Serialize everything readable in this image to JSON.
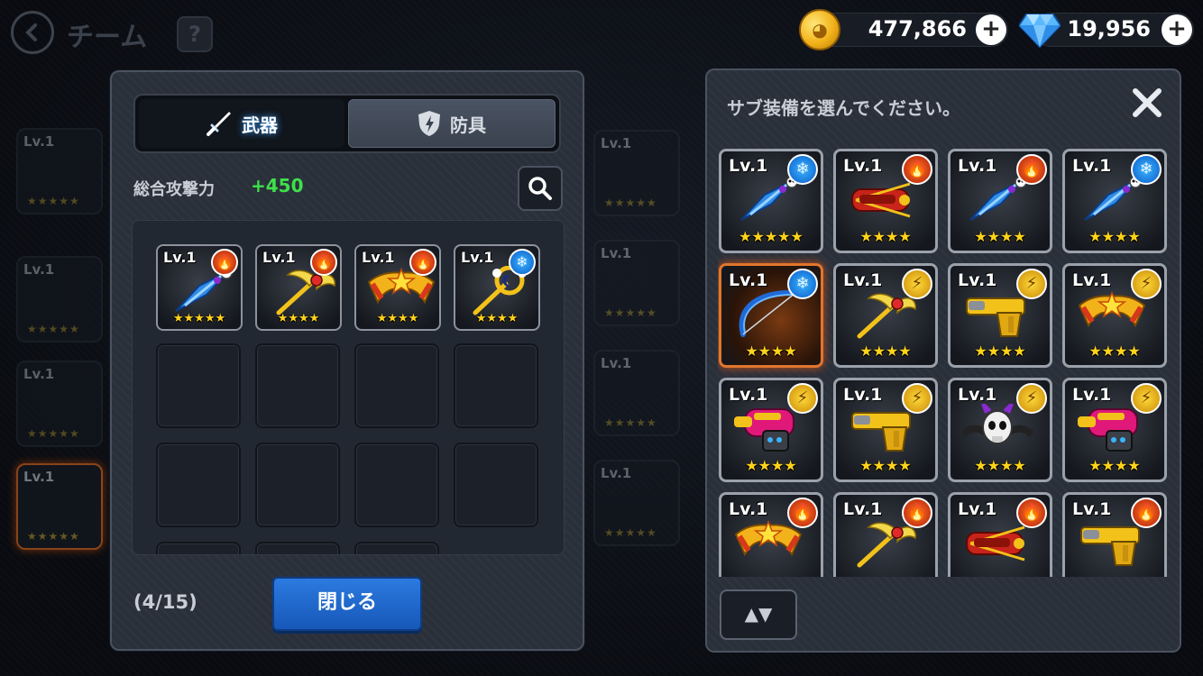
{
  "header": {
    "title": "チーム",
    "help_label": "?"
  },
  "currency": {
    "coins": "477,866",
    "gems": "19,956",
    "plus_label": "+"
  },
  "equip_panel": {
    "tabs": [
      {
        "label": "武器",
        "active": true,
        "icon": "sword-icon"
      },
      {
        "label": "防具",
        "active": false,
        "icon": "shield-icon"
      }
    ],
    "attack_label": "総合攻撃力",
    "attack_value": "+450",
    "count": "(4/15)",
    "close_label": "閉じる",
    "equipped": [
      {
        "level": "Lv.1",
        "element": "fire",
        "stars": "★★★★★",
        "icon": "dagger-icon"
      },
      {
        "level": "Lv.1",
        "element": "fire",
        "stars": "★★★★",
        "icon": "wing-staff-icon"
      },
      {
        "level": "Lv.1",
        "element": "fire",
        "stars": "★★★★",
        "icon": "boomerang-icon"
      },
      {
        "level": "Lv.1",
        "element": "ice",
        "stars": "★★★★",
        "icon": "moon-wand-icon"
      }
    ]
  },
  "select_panel": {
    "title": "サブ装備を選んでください。",
    "sort_label": "▲▼",
    "items": [
      {
        "level": "Lv.1",
        "element": "ice",
        "stars": "★★★★★",
        "icon": "dagger-icon",
        "selected": false
      },
      {
        "level": "Lv.1",
        "element": "fire",
        "stars": "★★★★",
        "icon": "crossbow-icon",
        "selected": false
      },
      {
        "level": "Lv.1",
        "element": "fire",
        "stars": "★★★★",
        "icon": "dagger-icon",
        "selected": false
      },
      {
        "level": "Lv.1",
        "element": "ice",
        "stars": "★★★★",
        "icon": "dagger-icon",
        "selected": false
      },
      {
        "level": "Lv.1",
        "element": "ice",
        "stars": "★★★★",
        "icon": "bow-icon",
        "selected": true
      },
      {
        "level": "Lv.1",
        "element": "bolt",
        "stars": "★★★★",
        "icon": "wing-staff-icon",
        "selected": false
      },
      {
        "level": "Lv.1",
        "element": "bolt",
        "stars": "★★★★",
        "icon": "pistol-icon",
        "selected": false
      },
      {
        "level": "Lv.1",
        "element": "bolt",
        "stars": "★★★★",
        "icon": "boomerang-icon",
        "selected": false
      },
      {
        "level": "Lv.1",
        "element": "bolt",
        "stars": "★★★★",
        "icon": "blaster-icon",
        "selected": false
      },
      {
        "level": "Lv.1",
        "element": "bolt",
        "stars": "★★★★",
        "icon": "pistol-icon",
        "selected": false
      },
      {
        "level": "Lv.1",
        "element": "bolt",
        "stars": "★★★★",
        "icon": "skull-icon",
        "selected": false
      },
      {
        "level": "Lv.1",
        "element": "bolt",
        "stars": "★★★★",
        "icon": "blaster-icon",
        "selected": false
      },
      {
        "level": "Lv.1",
        "element": "fire",
        "stars": "",
        "icon": "boomerang-icon",
        "selected": false
      },
      {
        "level": "Lv.1",
        "element": "fire",
        "stars": "",
        "icon": "wing-staff-icon",
        "selected": false
      },
      {
        "level": "Lv.1",
        "element": "fire",
        "stars": "",
        "icon": "crossbow-icon",
        "selected": false
      },
      {
        "level": "Lv.1",
        "element": "fire",
        "stars": "",
        "icon": "pistol-icon",
        "selected": false
      }
    ]
  },
  "background_team": {
    "slot_level": "Lv.1",
    "slot_stars": "★★★★★"
  }
}
